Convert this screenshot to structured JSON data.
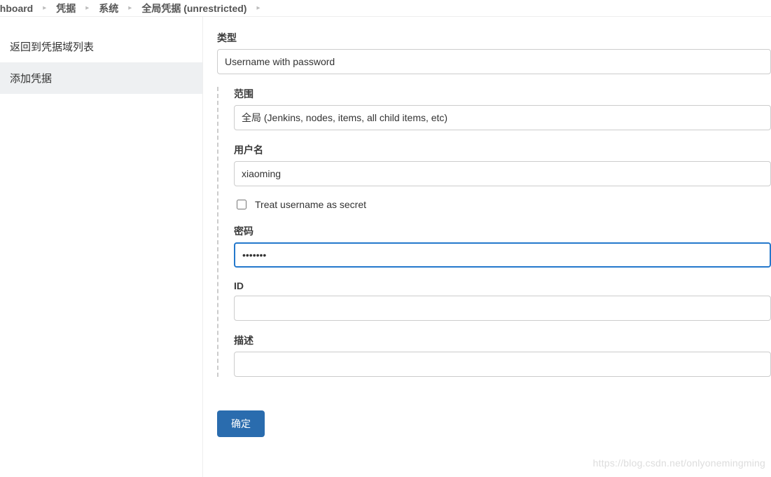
{
  "breadcrumb": {
    "items": [
      "shboard",
      "凭据",
      "系统",
      "全局凭据 (unrestricted)"
    ]
  },
  "sidebar": {
    "items": [
      {
        "label": "返回到凭据域列表",
        "active": false
      },
      {
        "label": "添加凭据",
        "active": true
      }
    ]
  },
  "form": {
    "type_label": "类型",
    "type_value": "Username with password",
    "scope_label": "范围",
    "scope_value": "全局 (Jenkins, nodes, items, all child items, etc)",
    "username_label": "用户名",
    "username_value": "xiaoming",
    "treat_secret_label": "Treat username as secret",
    "treat_secret_checked": false,
    "password_label": "密码",
    "password_value": "•••••••",
    "id_label": "ID",
    "id_value": "",
    "description_label": "描述",
    "description_value": "",
    "submit_label": "确定"
  },
  "watermark": "https://blog.csdn.net/onlyonemingming"
}
